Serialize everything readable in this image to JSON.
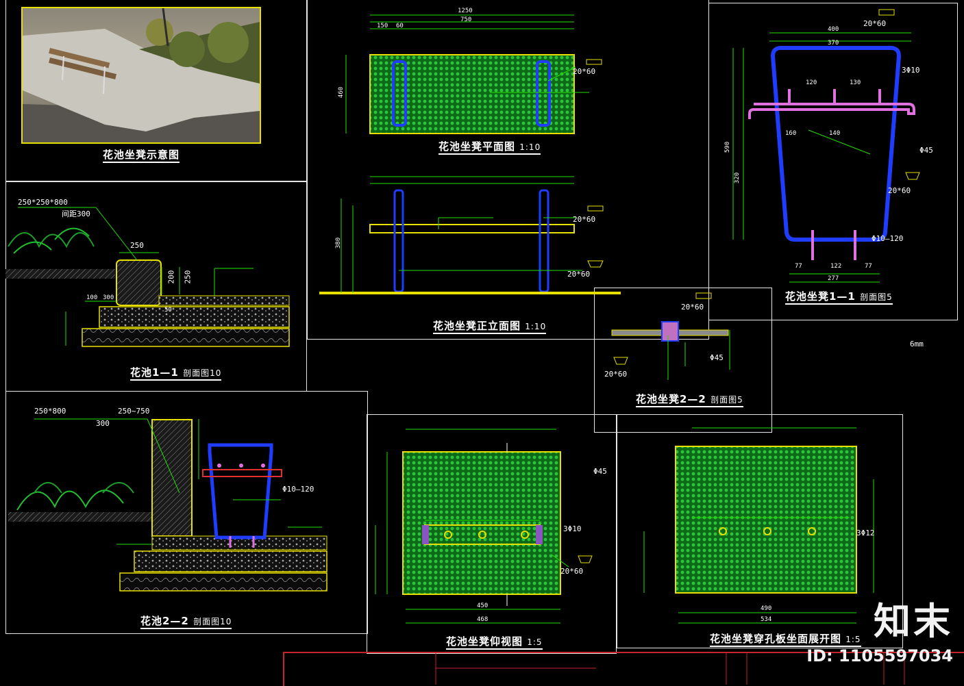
{
  "captions": {
    "photo": "花池坐凳示意图",
    "section_11": "花池1—1",
    "section_11_scale": "剖面图10",
    "section_22": "花池2—2",
    "section_22_scale": "剖面图10",
    "plan": "花池坐凳平面图",
    "plan_scale": "1:10",
    "elevation": "花池坐凳正立面图",
    "elevation_scale": "1:10",
    "seat_11": "花池坐凳1—1",
    "seat_11_scale": "剖面图5",
    "seat_22": "花池坐凳2—2",
    "seat_22_scale": "剖面图5",
    "bottom_view": "花池坐凳仰视图",
    "bottom_view_scale": "1:5",
    "unfold": "花池坐凳穿孔板坐面展开图",
    "unfold_scale": "1:5"
  },
  "annotations": {
    "stone_top": "250*250*800",
    "spacing_300": "间距300",
    "stone_side": "250*800",
    "range": "250~750",
    "spacing_300b": "300",
    "d250": "250",
    "d200": "200",
    "d250b": "250",
    "d50": "50",
    "d100": "100",
    "d300": "300",
    "tube": "20*60",
    "tube2": "20*60",
    "tube3": "20*60",
    "tube4": "20*60",
    "tube5": "20*60",
    "tube6": "20*60",
    "tube7": "20*60",
    "rod": "3Φ10",
    "rod2": "3Φ10",
    "phi": "Φ10—120",
    "phi2": "Φ10—120",
    "phi45": "Φ45",
    "phi45b": "Φ45",
    "phi45c": "Φ45",
    "phi12": "3Φ12",
    "plate_6mm": "6mm",
    "top_400": "400",
    "top_370": "370",
    "w277": "277",
    "w77": "77",
    "w122": "122",
    "w77b": "77",
    "w450": "450",
    "w468": "468",
    "w490": "490",
    "w534": "534",
    "w120": "120",
    "w130": "130",
    "w160": "160",
    "w140": "140",
    "w150": "150",
    "w60": "60",
    "w1250": "1250",
    "w750": "750",
    "h460": "460",
    "h380": "380",
    "h590": "590",
    "h320": "320"
  },
  "watermark": {
    "logo": "知末",
    "id": "ID: 1105597034"
  },
  "colors": {
    "frame": "#e6e6e6",
    "outline_yellow": "#e8e000",
    "perforated_green": "#1e9e2a",
    "dim_green": "#22e000",
    "steel_blue": "#1f3cff",
    "rebar_magenta": "#e070e0",
    "title_red": "#c8222a"
  }
}
